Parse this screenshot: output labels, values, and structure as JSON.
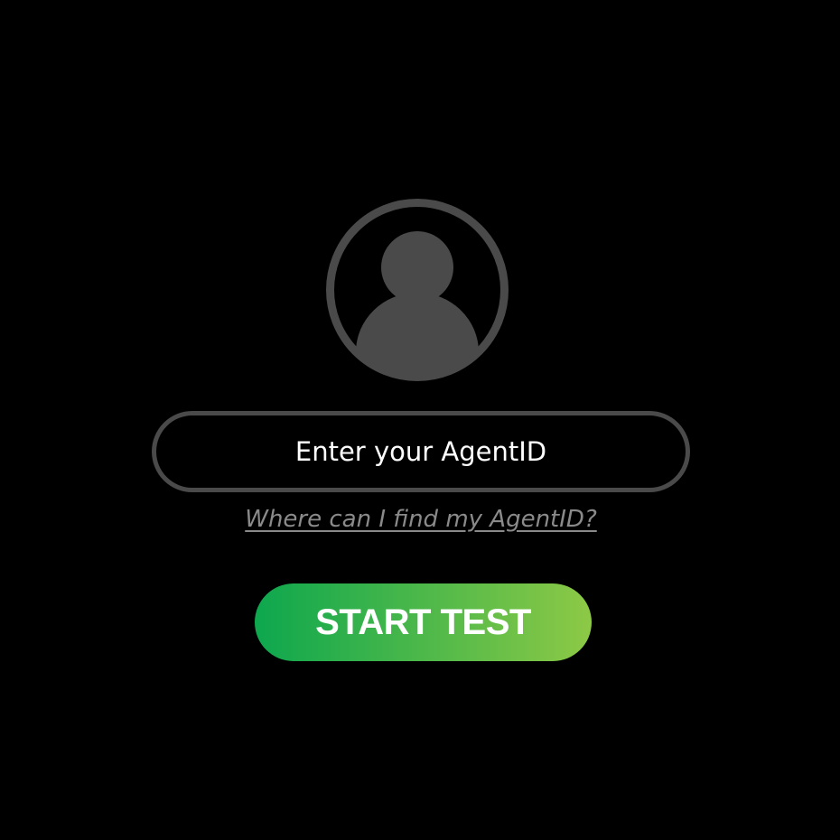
{
  "colors": {
    "background": "#000000",
    "avatar_gray": "#4a4a4a",
    "input_border": "#4a4a4a",
    "link_gray": "#8a8a8a",
    "button_gradient_start": "#0da74e",
    "button_gradient_end": "#8dc946",
    "text_white": "#ffffff"
  },
  "avatar": {
    "icon": "user-avatar-icon"
  },
  "agent_input": {
    "placeholder": "Enter your AgentID",
    "value": ""
  },
  "help_link": {
    "label": "Where can I find my AgentID?"
  },
  "start_button": {
    "label": "START TEST"
  }
}
